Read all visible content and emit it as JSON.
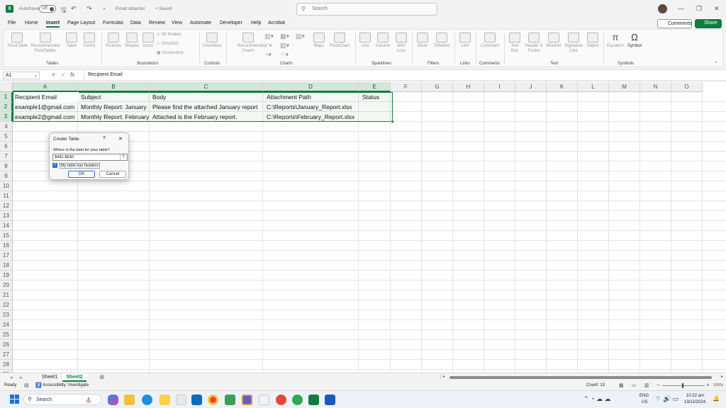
{
  "titlebar": {
    "autosave_label": "AutoSave",
    "autosave_state": "Off",
    "doc_title": "Email attacher",
    "saved_status": "• Saved",
    "search_placeholder": "Search"
  },
  "menu": {
    "items": [
      "File",
      "Home",
      "Insert",
      "Page Layout",
      "Formulas",
      "Data",
      "Review",
      "View",
      "Automate",
      "Developer",
      "Help",
      "Acrobat"
    ],
    "active": "Insert",
    "comments_label": "Comments",
    "share_label": "Share"
  },
  "ribbon": {
    "items": [
      {
        "label": "PivotTable"
      },
      {
        "label": "Recommended PivotTables"
      },
      {
        "label": "Table"
      },
      {
        "label": "Forms"
      },
      {
        "label": "Pictures"
      },
      {
        "label": "Shapes"
      },
      {
        "label": "Icons"
      },
      {
        "label": "3D Models"
      },
      {
        "label": "SmartArt"
      },
      {
        "label": "Screenshot"
      },
      {
        "label": "Checkbox"
      },
      {
        "label": "Recommended Charts"
      },
      {
        "label": "Maps"
      },
      {
        "label": "PivotChart"
      },
      {
        "label": "Line"
      },
      {
        "label": "Column"
      },
      {
        "label": "Win/ Loss"
      },
      {
        "label": "Slicer"
      },
      {
        "label": "Timeline"
      },
      {
        "label": "Link"
      },
      {
        "label": "Comment"
      },
      {
        "label": "Text Box"
      },
      {
        "label": "Header & Footer"
      },
      {
        "label": "WordArt"
      },
      {
        "label": "Signature Line"
      },
      {
        "label": "Object"
      },
      {
        "label": "Equation"
      },
      {
        "label": "Symbol"
      }
    ],
    "groups": [
      "Tables",
      "Illustrations",
      "Controls",
      "Charts",
      "Sparklines",
      "Filters",
      "Links",
      "Comments",
      "Text",
      "Symbols"
    ]
  },
  "formula_bar": {
    "name_box": "A1",
    "fx": "fx",
    "content": "Recipient Email"
  },
  "grid": {
    "columns": [
      "A",
      "B",
      "C",
      "D",
      "E",
      "F",
      "G",
      "H",
      "I",
      "J",
      "K",
      "L",
      "M",
      "N",
      "O"
    ],
    "rows": [
      "1",
      "2",
      "3",
      "4",
      "5",
      "6",
      "7",
      "8",
      "9",
      "10",
      "11",
      "12",
      "13",
      "14",
      "15",
      "16",
      "17",
      "18",
      "19",
      "20",
      "21",
      "22",
      "23",
      "24",
      "25",
      "26",
      "27",
      "28",
      "29"
    ],
    "cells": {
      "A1": "Recipient Email",
      "B1": "Subject",
      "C1": "Body",
      "D1": "Attachment Path",
      "E1": "Status",
      "A2": "example1@gmail.com",
      "B2": "Monthly Report: January",
      "C2": "Please find the attached January report",
      "D2": "C:\\Reports\\January_Report.xlsx",
      "A3": "example2@gmail.com",
      "B3": "Monthly Report: February",
      "C3": "Attached is the February report.",
      "D3": "C:\\Reports\\February_Report.xlsx"
    }
  },
  "dialog": {
    "title": "Create Table",
    "help": "?",
    "prompt": "Where is the data for your table?",
    "range": "$A$1:$E$3",
    "checkbox_label": "My table has headers",
    "ok": "OK",
    "cancel": "Cancel"
  },
  "sheets": {
    "tabs": [
      "Sheet1",
      "Sheet2"
    ],
    "active": "Sheet2"
  },
  "status": {
    "ready": "Ready",
    "accessibility": "Accessibility: Investigate",
    "count": "Count: 13",
    "zoom": "100%"
  },
  "taskbar": {
    "search": "Search",
    "lang": "ENG",
    "region": "US",
    "time": "10:22 am",
    "date": "13/12/2024"
  },
  "colors": {
    "accent": "#107c41",
    "selection": "#d3e6da"
  }
}
